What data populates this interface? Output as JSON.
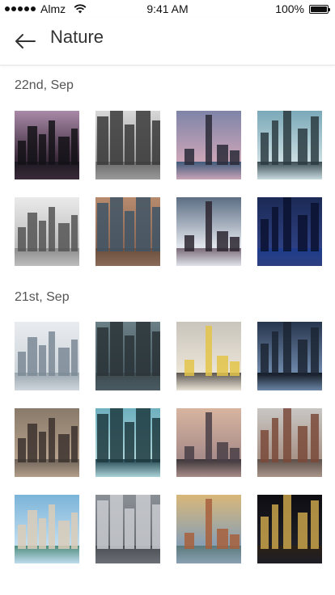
{
  "status": {
    "carrier": "Almz",
    "time": "9:41 AM",
    "battery": "100%",
    "battery_level": 1.0
  },
  "header": {
    "title": "Nature",
    "back_icon": "arrow-left-icon"
  },
  "sections": [
    {
      "date": "22nd, Sep",
      "photos": [
        {
          "name": "photo-city-reflection-dusk",
          "sky": "#a98aa8",
          "sky2": "#3a2a3a",
          "ground": "#1d1a22",
          "bld": "#141218"
        },
        {
          "name": "photo-skyscrapers-bw",
          "sky": "#d8d8d8",
          "sky2": "#9a9a9a",
          "ground": "#6a6a6a",
          "bld": "#3a3a3a"
        },
        {
          "name": "photo-eiffel-tower",
          "sky": "#7e84a8",
          "sky2": "#c9a4b7",
          "ground": "#3f5a7a",
          "bld": "#2a2a38"
        },
        {
          "name": "photo-modern-towers",
          "sky": "#7aa8b8",
          "sky2": "#c7dbe0",
          "ground": "#3a4a50",
          "bld": "#2b3b42"
        },
        {
          "name": "photo-statue-of-liberty",
          "sky": "#eaeaea",
          "sky2": "#bdbdbd",
          "ground": "#8c8c8c",
          "bld": "#555555"
        },
        {
          "name": "photo-tilt-shift-city",
          "sky": "#b78a6c",
          "sky2": "#8a6a58",
          "ground": "#6b4e3e",
          "bld": "#3f5566"
        },
        {
          "name": "photo-crowd-street",
          "sky": "#5c6e84",
          "sky2": "#dfe3ea",
          "ground": "#7a6a78",
          "bld": "#2b2630"
        },
        {
          "name": "photo-night-skyline",
          "sky": "#1b2a55",
          "sky2": "#2d3f80",
          "ground": "#1d3c8c",
          "bld": "#0b1230"
        }
      ]
    },
    {
      "date": "21st, Sep",
      "photos": [
        {
          "name": "photo-harbor-towers",
          "sky": "#e9ecef",
          "sky2": "#cfd6dc",
          "ground": "#9aa6ae",
          "bld": "#7b8a96"
        },
        {
          "name": "photo-aerial-city",
          "sky": "#6b7f86",
          "sky2": "#4a5b63",
          "ground": "#3d4a4f",
          "bld": "#2a3438"
        },
        {
          "name": "photo-tram",
          "sky": "#c9c4bc",
          "sky2": "#e9e3d6",
          "ground": "#5b5650",
          "bld": "#e3c44a"
        },
        {
          "name": "photo-stormy-sky",
          "sky": "#27354d",
          "sky2": "#6b85a6",
          "ground": "#111821",
          "bld": "#1b2533"
        },
        {
          "name": "photo-empty-street",
          "sky": "#8a7a6a",
          "sky2": "#b39f8a",
          "ground": "#6e6258",
          "bld": "#3c332e"
        },
        {
          "name": "photo-taipei-101",
          "sky": "#6fb0bf",
          "sky2": "#a9d2d6",
          "ground": "#234650",
          "bld": "#1d3940"
        },
        {
          "name": "photo-empire-state",
          "sky": "#d8b5a0",
          "sky2": "#a98d8a",
          "ground": "#3a3538",
          "bld": "#4a4046"
        },
        {
          "name": "photo-rainy-street",
          "sky": "#c9c6c3",
          "sky2": "#a9958a",
          "ground": "#5c4f49",
          "bld": "#7a4a3a"
        },
        {
          "name": "photo-venice-canal",
          "sky": "#7bb4d9",
          "sky2": "#bfdcee",
          "ground": "#4f8c7c",
          "bld": "#d9cdb9"
        },
        {
          "name": "photo-aerial-downtown",
          "sky": "#8a8f96",
          "sky2": "#6b7076",
          "ground": "#4a4e53",
          "bld": "#c9cbd0"
        },
        {
          "name": "photo-old-town-rooftops",
          "sky": "#d9b77a",
          "sky2": "#8aa0b2",
          "ground": "#5a7a7c",
          "bld": "#a8603c"
        },
        {
          "name": "photo-city-lights-night",
          "sky": "#0d0d12",
          "sky2": "#1e1e26",
          "ground": "#2a2016",
          "bld": "#c9a34a"
        }
      ]
    }
  ]
}
